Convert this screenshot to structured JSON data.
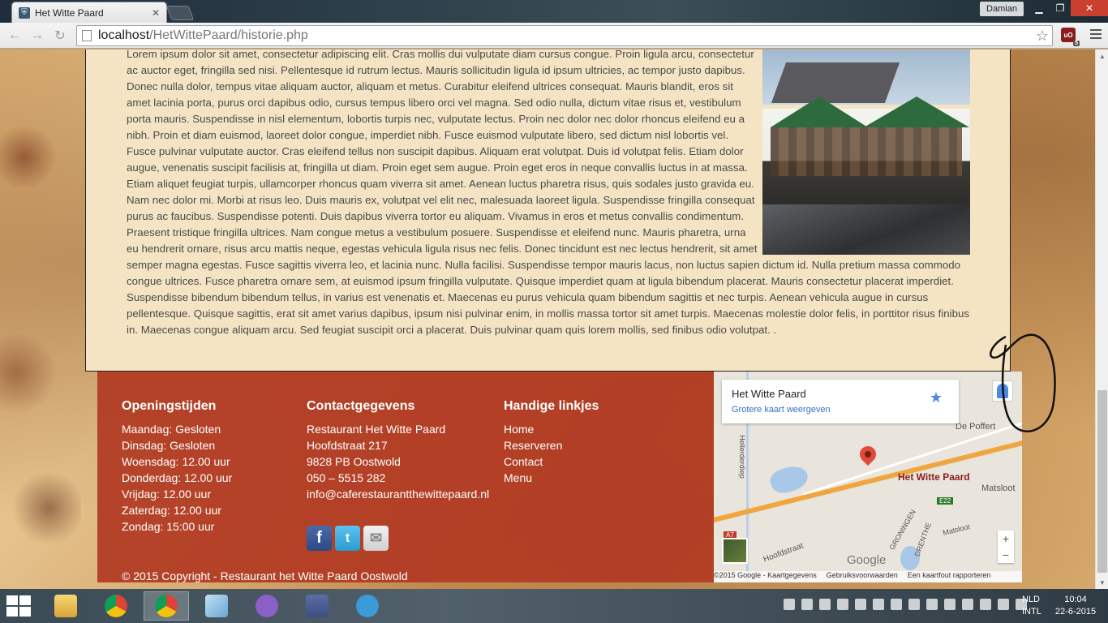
{
  "browser": {
    "tab_title": "Het Witte Paard",
    "tab_close": "✕",
    "user": "Damian",
    "url_host": "localhost",
    "url_path": "/HetWittePaard/historie.php",
    "extension_badge": "5"
  },
  "article": {
    "text": "Lorem ipsum dolor sit amet, consectetur adipiscing elit. Cras mollis dui vulputate diam cursus congue. Proin ligula arcu, consectetur ac auctor eget, fringilla sed nisi. Pellentesque id rutrum lectus. Mauris sollicitudin ligula id ipsum ultricies, ac tempor justo dapibus. Donec nulla dolor, tempus vitae aliquam auctor, aliquam et metus. Curabitur eleifend ultrices consequat. Mauris blandit, eros sit amet lacinia porta, purus orci dapibus odio, cursus tempus libero orci vel magna. Sed odio nulla, dictum vitae risus et, vestibulum porta mauris. Suspendisse in nisl elementum, lobortis turpis nec, vulputate lectus. Proin nec dolor nec dolor rhoncus eleifend eu a nibh. Proin et diam euismod, laoreet dolor congue, imperdiet nibh. Fusce euismod vulputate libero, sed dictum nisl lobortis vel. Fusce pulvinar vulputate auctor. Cras eleifend tellus non suscipit dapibus. Aliquam erat volutpat. Duis id volutpat felis. Etiam dolor augue, venenatis suscipit facilisis at, fringilla ut diam. Proin eget sem augue. Proin eget eros in neque convallis luctus in at massa. Etiam aliquet feugiat turpis, ullamcorper rhoncus quam viverra sit amet. Aenean luctus pharetra risus, quis sodales justo gravida eu. Nam nec dolor mi. Morbi at risus leo. Duis mauris ex, volutpat vel elit nec, malesuada laoreet ligula. Suspendisse fringilla consequat purus ac faucibus. Suspendisse potenti. Duis dapibus viverra tortor eu aliquam. Vivamus in eros et metus convallis condimentum. Praesent tristique fringilla ultrices. Nam congue metus a vestibulum posuere. Suspendisse et eleifend nunc. Mauris pharetra, urna eu hendrerit ornare, risus arcu mattis neque, egestas vehicula ligula risus nec felis. Donec tincidunt est nec lectus hendrerit, sit amet semper magna egestas. Fusce sagittis viverra leo, et lacinia nunc. Nulla facilisi. Suspendisse tempor mauris lacus, non luctus sapien dictum id. Nulla pretium massa commodo congue ultrices. Fusce pharetra ornare sem, at euismod ipsum fringilla vulputate. Quisque imperdiet quam at ligula bibendum placerat. Mauris consectetur placerat imperdiet. Suspendisse bibendum bibendum tellus, in varius est venenatis et. Maecenas eu purus vehicula quam bibendum sagittis et nec turpis. Aenean vehicula augue in cursus pellentesque. Quisque sagittis, erat sit amet varius dapibus, ipsum nisi pulvinar enim, in mollis massa tortor sit amet turpis. Maecenas molestie dolor felis, in porttitor risus finibus in. Maecenas congue aliquam arcu. Sed feugiat suscipit orci a placerat. Duis pulvinar quam quis lorem mollis, sed finibus odio volutpat. ."
  },
  "footer": {
    "hours": {
      "title": "Openingstijden",
      "lines": [
        "Maandag: Gesloten",
        "Dinsdag: Gesloten",
        "Woensdag: 12.00 uur",
        "Donderdag: 12.00 uur",
        "Vrijdag: 12.00 uur",
        "Zaterdag: 12.00 uur",
        "Zondag: 15:00 uur"
      ]
    },
    "contact": {
      "title": "Contactgegevens",
      "lines": [
        "Restaurant Het Witte Paard",
        "Hoofdstraat 217",
        "9828 PB Oostwold",
        "050 – 5515 282",
        "info@caferestaurantthewittepaard.nl"
      ]
    },
    "links": {
      "title": "Handige linkjes",
      "items": [
        "Home",
        "Reserveren",
        "Contact",
        "Menu"
      ]
    },
    "social": {
      "facebook": "f",
      "twitter": "t",
      "mail": "✉"
    },
    "copyright": "© 2015 Copyright - Restaurant het Witte Paard Oostwold"
  },
  "map": {
    "card_title": "Het Witte Paard",
    "card_link": "Grotere kaart weergeven",
    "place_label": "Het Witte Paard",
    "label_poffert": "De Poffert",
    "label_matsloot": "Matsloot",
    "label_matsloot2": "Matsloot",
    "label_hoofdstraat": "Hoofdstraat",
    "label_heiderdiep": "Hellerderdiep",
    "label_groningen": "GRONINGEN",
    "label_drenthe": "DRENTHE",
    "highway": "E22",
    "highway_a7": "A7",
    "zoom_in": "+",
    "zoom_out": "−",
    "google": "Google",
    "attribution": [
      "©2015 Google - Kaartgegevens",
      "Gebruiksvoorwaarden",
      "Een kaartfout rapporteren"
    ]
  },
  "taskbar": {
    "lang_top": "NLD",
    "lang_bottom": "INTL",
    "time": "10:04",
    "date": "22-6-2015"
  }
}
